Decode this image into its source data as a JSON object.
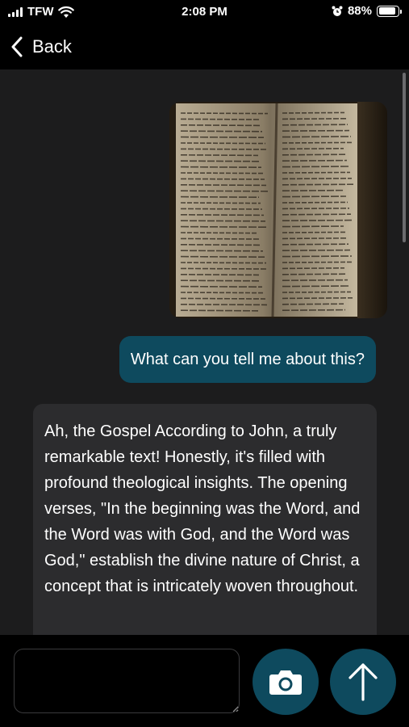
{
  "status_bar": {
    "carrier": "TFW",
    "time": "2:08 PM",
    "battery_percent": "88%",
    "battery_level": 0.88,
    "icons": [
      "signal-icon",
      "wifi-icon",
      "alarm-icon",
      "battery-icon"
    ]
  },
  "nav": {
    "back_label": "Back",
    "back_icon": "chevron-left-icon"
  },
  "chat": {
    "messages": [
      {
        "role": "user",
        "type": "image",
        "description_icon": "photo"
      },
      {
        "role": "user",
        "type": "text",
        "text": "What can you tell me about this?"
      },
      {
        "role": "assistant",
        "type": "text",
        "text": "Ah, the Gospel According to John, a truly remarkable text! Honestly, it's filled with profound theological insights. The opening verses, \"In the beginning was the Word, and the Word was with God, and the Word was God,\" establish the divine nature of Christ, a concept that is intricately woven throughout."
      }
    ]
  },
  "input": {
    "value": "",
    "placeholder": ""
  },
  "buttons": {
    "camera_icon": "camera-icon",
    "send_icon": "arrow-up-icon"
  },
  "colors": {
    "accent": "#0e4a5e",
    "chat_background": "#1c1c1d",
    "assistant_bubble": "#2c2c2e",
    "page_background": "#000000"
  }
}
